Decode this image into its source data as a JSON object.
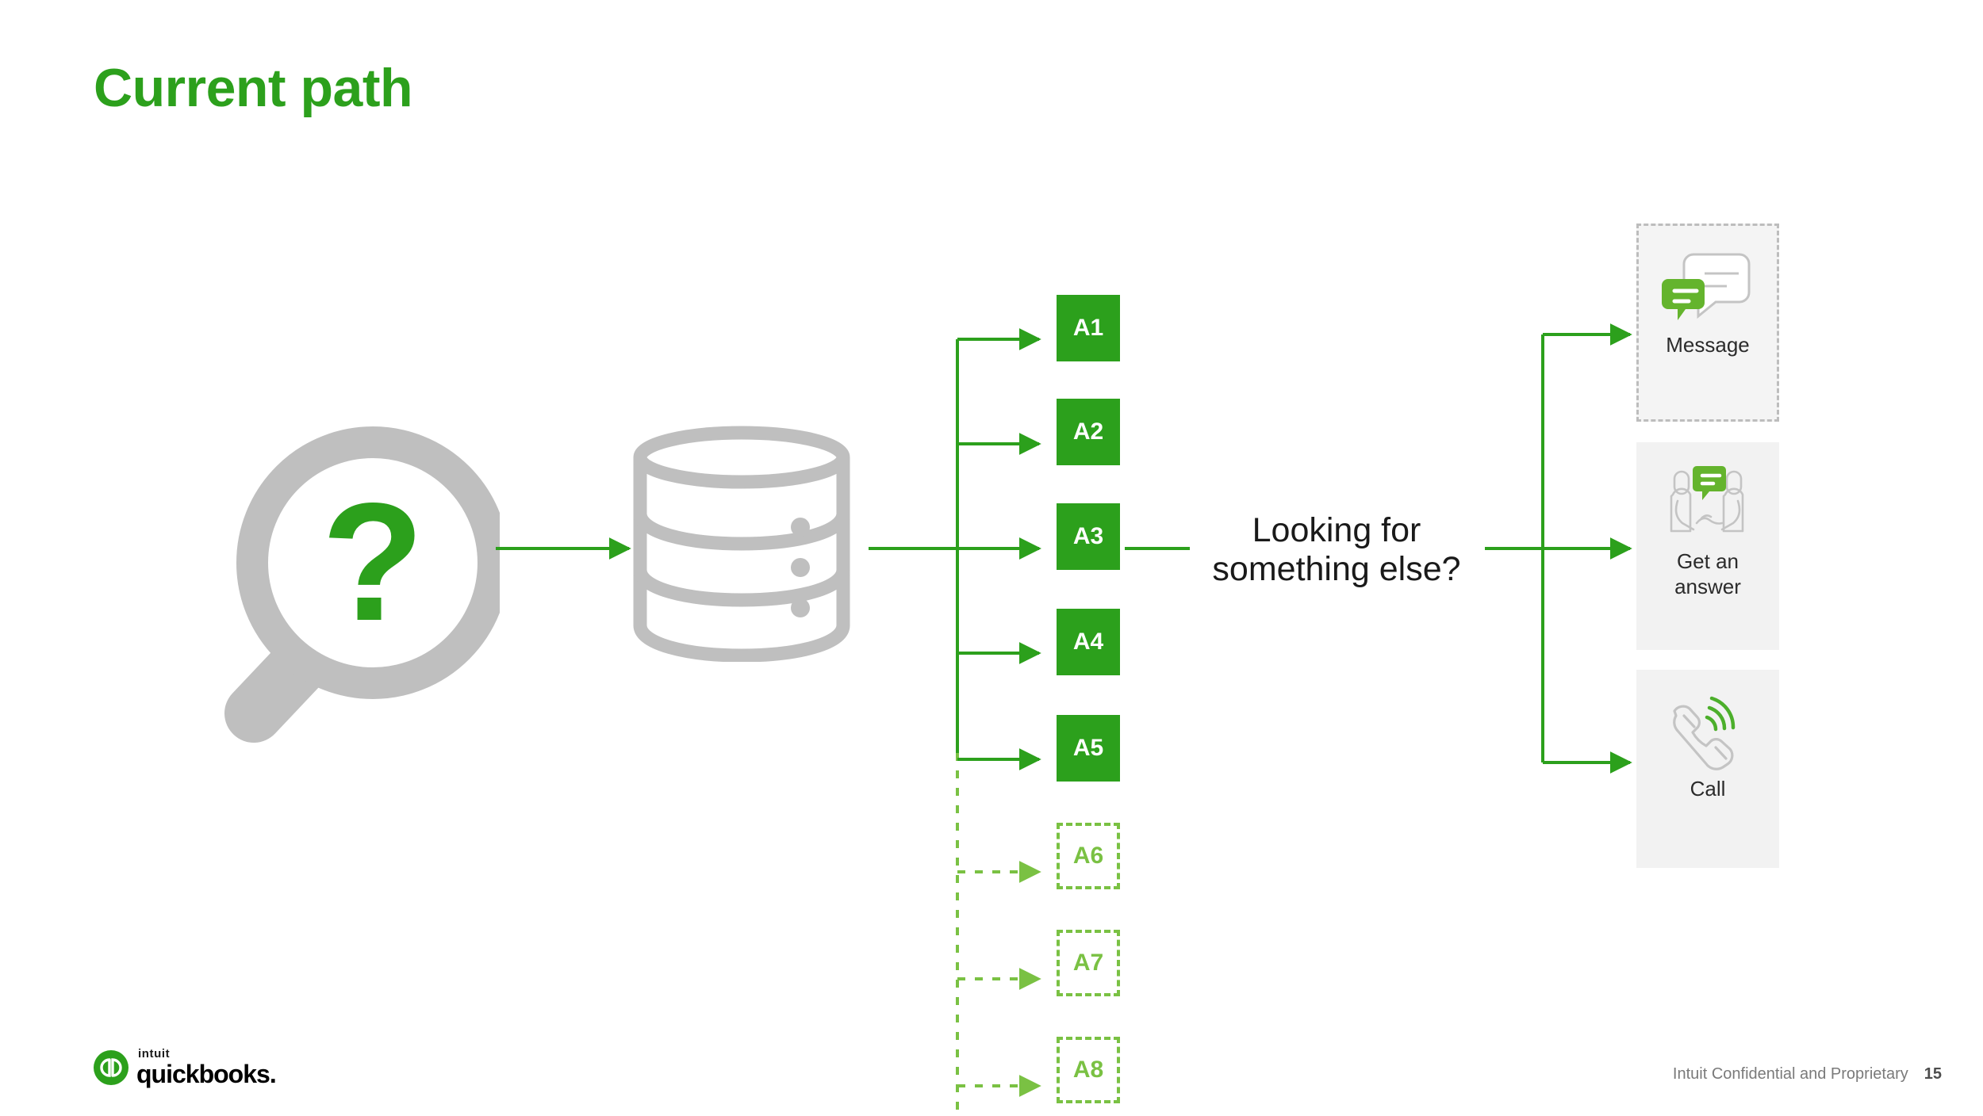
{
  "slide": {
    "title": "Current path",
    "accent_green": "#2CA01C",
    "light_green": "#7AC143",
    "gray": "#BFBFBF",
    "card_bg": "#F2F2F2"
  },
  "search": {
    "icon": "magnifying-glass-question-icon",
    "glyph": "?"
  },
  "datastore": {
    "icon": "database-cylinder-icon"
  },
  "articles": {
    "available": [
      {
        "label": "A1",
        "state": "solid"
      },
      {
        "label": "A2",
        "state": "solid"
      },
      {
        "label": "A3",
        "state": "solid"
      },
      {
        "label": "A4",
        "state": "solid"
      },
      {
        "label": "A5",
        "state": "solid"
      }
    ],
    "missing": [
      {
        "label": "A6",
        "state": "dashed"
      },
      {
        "label": "A7",
        "state": "dashed"
      },
      {
        "label": "A8",
        "state": "dashed"
      }
    ]
  },
  "prompt": {
    "line1": "Looking for",
    "line2": "something else?"
  },
  "channels": [
    {
      "label": "Message",
      "icon": "chat-bubbles-icon",
      "outlined": true
    },
    {
      "label": "Get an\nanswer",
      "label_line1": "Get an",
      "label_line2": "answer",
      "icon": "handshake-chat-icon",
      "outlined": false
    },
    {
      "label": "Call",
      "icon": "phone-ringing-icon",
      "outlined": false
    }
  ],
  "footer": {
    "brand_intuit": "intuit",
    "brand_product": "quickbooks.",
    "confidentiality": "Intuit Confidential and Proprietary",
    "page_number": "15"
  }
}
